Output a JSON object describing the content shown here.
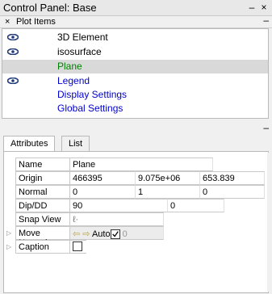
{
  "window": {
    "title": "Control Panel: Base",
    "minimize": "–",
    "close": "×"
  },
  "plot_items": {
    "header": "Plot Items",
    "close": "×",
    "minimize": "–",
    "items": [
      {
        "label": "3D Element",
        "visible_eye": true,
        "selected": false,
        "color": "#000000"
      },
      {
        "label": "isosurface",
        "visible_eye": true,
        "selected": false,
        "color": "#000000"
      },
      {
        "label": "Plane",
        "visible_eye": false,
        "selected": true,
        "color": "#008000"
      },
      {
        "label": "Legend",
        "visible_eye": true,
        "selected": false,
        "color": "#0000cc"
      },
      {
        "label": "Display Settings",
        "visible_eye": false,
        "selected": false,
        "color": "#0000cc"
      },
      {
        "label": "Global Settings",
        "visible_eye": false,
        "selected": false,
        "color": "#0000cc"
      }
    ]
  },
  "lower_panel": {
    "minimize": "–",
    "tabs": [
      {
        "label": "Attributes",
        "active": true
      },
      {
        "label": "List",
        "active": false
      }
    ],
    "attributes": {
      "name_label": "Name",
      "name_value": "Plane",
      "origin_label": "Origin",
      "origin_x": "466395",
      "origin_y": "9.075e+06",
      "origin_z": "653.839",
      "normal_label": "Normal",
      "normal_x": "0",
      "normal_y": "1",
      "normal_z": "0",
      "dipdd_label": "Dip/DD",
      "dip": "90",
      "dd": "0",
      "snap_label": "Snap View",
      "snap_value": "ℓ·",
      "move_normal_label": "Move Normal",
      "move_normal_arrows": "⇦ ⇨",
      "auto_label": "Auto",
      "auto_checked": true,
      "auto_value": "0",
      "caption_label": "Caption",
      "caption_checked": false
    }
  }
}
